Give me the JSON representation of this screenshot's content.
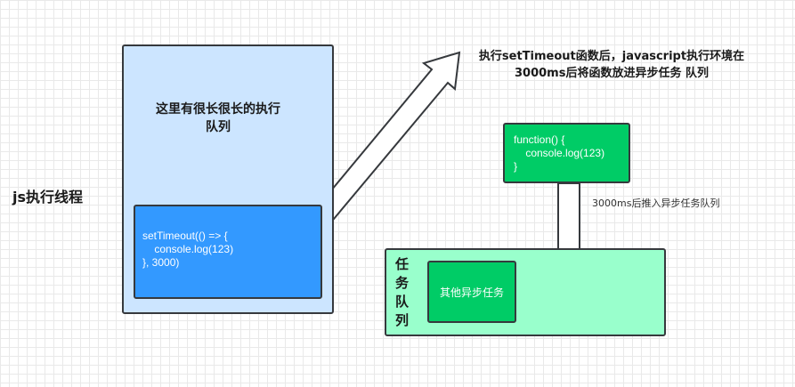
{
  "thread_label": "js执行线程",
  "call_stack": {
    "text": "这里有很长很长的执行队列",
    "code": "setTimeout(() => {\n    console.log(123)\n}, 3000)"
  },
  "note_top": "执行setTimeout函数后，javascript执行环境在 3000ms后将函数放进异步任务 队列",
  "callback_code": "function() {\n    console.log(123)\n}",
  "note_right": "3000ms后推入异步任务队列",
  "task_queue": {
    "label": "任务队列",
    "item": "其他异步任务"
  },
  "colors": {
    "stack_bg": "#cce5ff",
    "code_bg": "#3399ff",
    "callback_bg": "#00cc66",
    "queue_bg": "#99ffcc",
    "border": "#36393d"
  }
}
